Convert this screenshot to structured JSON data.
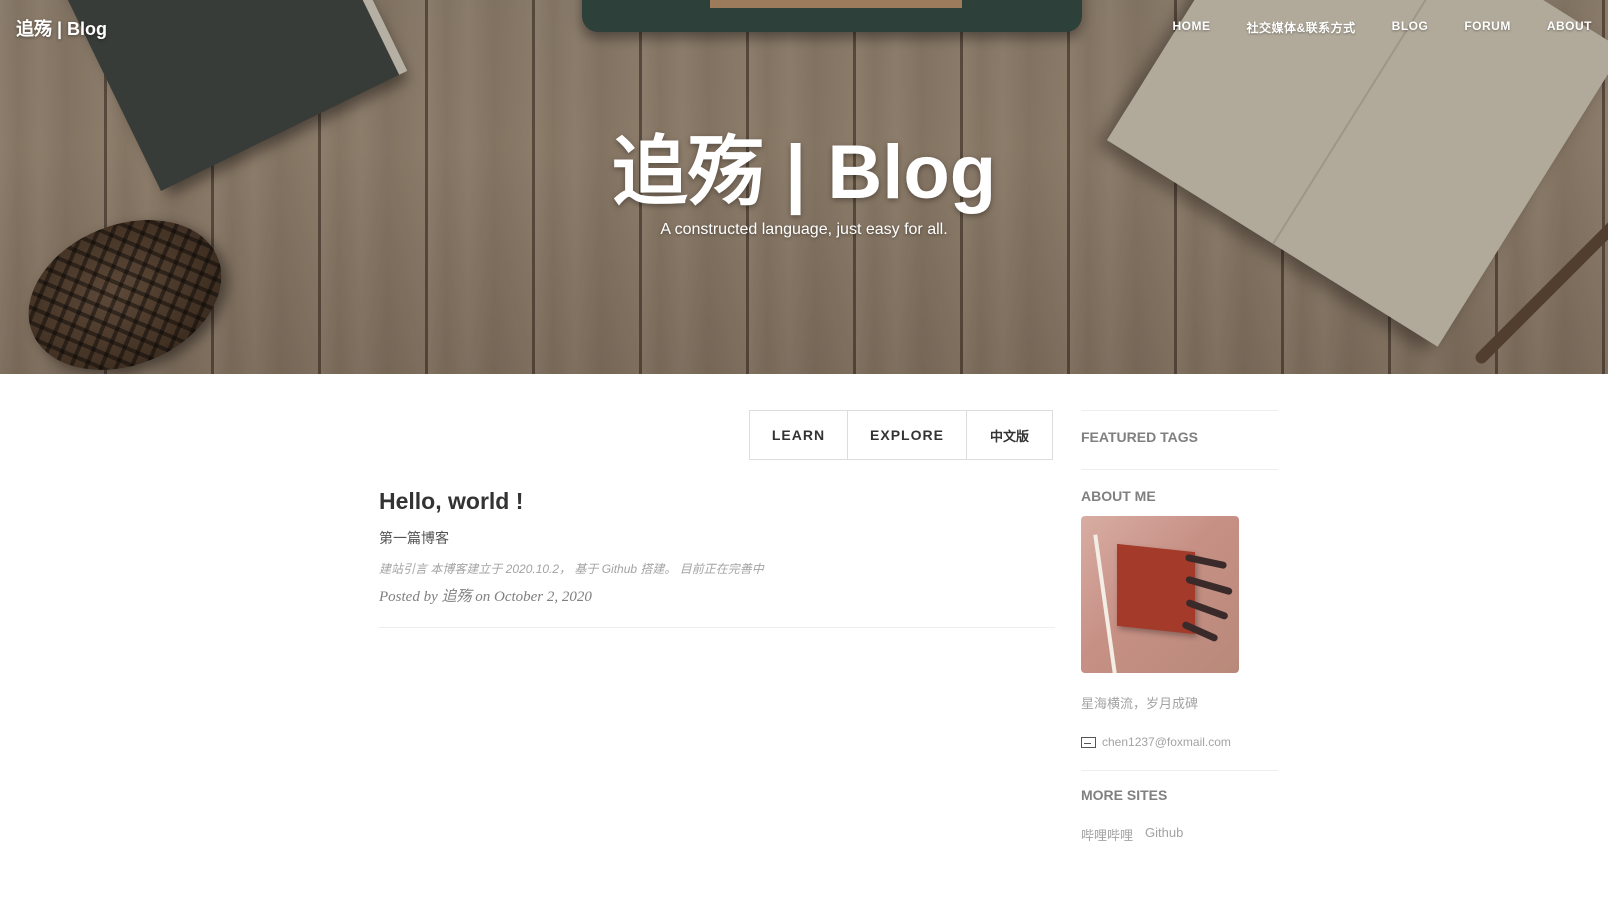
{
  "nav": {
    "brand": "追殇 | Blog",
    "items": [
      {
        "label": "HOME"
      },
      {
        "label": "社交媒体&联系方式"
      },
      {
        "label": "BLOG"
      },
      {
        "label": "FORUM"
      },
      {
        "label": "ABOUT"
      }
    ]
  },
  "hero": {
    "title": "追殇 | Blog",
    "subtitle": "A constructed language, just easy for all."
  },
  "catalog": {
    "learn": "LEARN",
    "explore": "EXPLORE",
    "chinese": "中文版"
  },
  "post": {
    "title": "Hello, world !",
    "subtitle": "第一篇博客",
    "excerpt": "建站引言 本博客建立于 2020.10.2， 基于 Github 搭建。 目前正在完善中",
    "meta": "Posted by 追殇 on October 2, 2020"
  },
  "sidebar": {
    "featured_tags": "FEATURED TAGS",
    "about_me": "ABOUT ME",
    "motto": "星海横流，岁月成碑",
    "email": "chen1237@foxmail.com",
    "more_sites": "MORE SITES",
    "sites": [
      {
        "label": "哔哩哔哩"
      },
      {
        "label": "Github"
      }
    ]
  }
}
